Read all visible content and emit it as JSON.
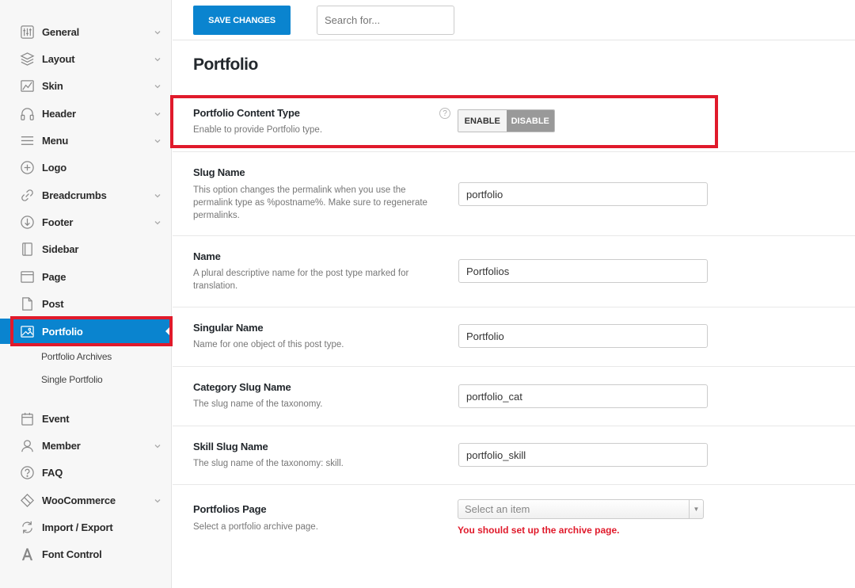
{
  "sidebar": {
    "items": [
      {
        "label": "General",
        "icon": "sliders-icon",
        "chevron": true
      },
      {
        "label": "Layout",
        "icon": "layers-icon",
        "chevron": true
      },
      {
        "label": "Skin",
        "icon": "skin-icon",
        "chevron": true
      },
      {
        "label": "Header",
        "icon": "headphones-icon",
        "chevron": true
      },
      {
        "label": "Menu",
        "icon": "menu-icon",
        "chevron": true
      },
      {
        "label": "Logo",
        "icon": "plus-circle-icon",
        "chevron": false
      },
      {
        "label": "Breadcrumbs",
        "icon": "link-icon",
        "chevron": true
      },
      {
        "label": "Footer",
        "icon": "arrow-down-circle-icon",
        "chevron": true
      },
      {
        "label": "Sidebar",
        "icon": "sidebar-icon",
        "chevron": false
      },
      {
        "label": "Page",
        "icon": "page-icon",
        "chevron": false
      },
      {
        "label": "Post",
        "icon": "post-icon",
        "chevron": false
      },
      {
        "label": "Portfolio",
        "icon": "image-icon",
        "chevron": false,
        "active": true
      },
      {
        "label": "Event",
        "icon": "calendar-icon",
        "chevron": false
      },
      {
        "label": "Member",
        "icon": "user-icon",
        "chevron": true
      },
      {
        "label": "FAQ",
        "icon": "question-circle-icon",
        "chevron": false
      },
      {
        "label": "WooCommerce",
        "icon": "woocommerce-icon",
        "chevron": true
      },
      {
        "label": "Import / Export",
        "icon": "import-export-icon",
        "chevron": false
      },
      {
        "label": "Font Control",
        "icon": "font-icon",
        "chevron": false
      }
    ],
    "subitems": [
      {
        "label": "Portfolio Archives"
      },
      {
        "label": "Single Portfolio"
      }
    ]
  },
  "toolbar": {
    "save_label": "SAVE CHANGES",
    "search_placeholder": "Search for..."
  },
  "page": {
    "title": "Portfolio"
  },
  "fields": {
    "content_type": {
      "title": "Portfolio Content Type",
      "desc": "Enable to provide Portfolio type.",
      "help": "?",
      "enable_label": "ENABLE",
      "disable_label": "DISABLE",
      "selected": "DISABLE"
    },
    "slug_name": {
      "title": "Slug Name",
      "desc": "This option changes the permalink when you use the permalink type as %postname%. Make sure to regenerate permalinks.",
      "value": "portfolio"
    },
    "name": {
      "title": "Name",
      "desc": "A plural descriptive name for the post type marked for translation.",
      "value": "Portfolios"
    },
    "singular_name": {
      "title": "Singular Name",
      "desc": "Name for one object of this post type.",
      "value": "Portfolio"
    },
    "category_slug": {
      "title": "Category Slug Name",
      "desc": "The slug name of the taxonomy.",
      "value": "portfolio_cat"
    },
    "skill_slug": {
      "title": "Skill Slug Name",
      "desc": "The slug name of the taxonomy: skill.",
      "value": "portfolio_skill"
    },
    "portfolios_page": {
      "title": "Portfolios Page",
      "desc": "Select a portfolio archive page.",
      "placeholder": "Select an item",
      "error": "You should set up the archive page."
    }
  },
  "colors": {
    "accent": "#0a84cf",
    "highlight": "#e01a2b",
    "toggle_active": "#999999"
  }
}
